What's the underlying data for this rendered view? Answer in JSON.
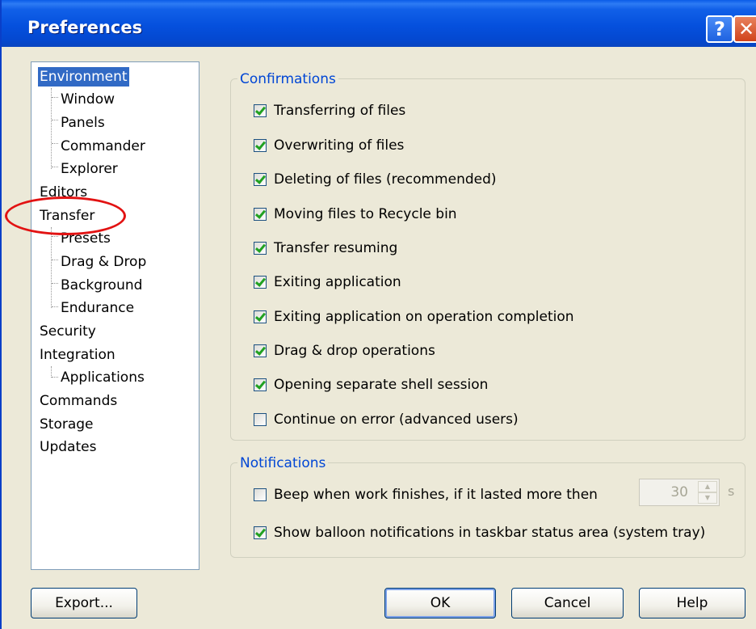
{
  "window": {
    "title": "Preferences",
    "help_glyph": "?",
    "close_glyph": "✕"
  },
  "tree": {
    "items": [
      {
        "label": "Environment",
        "level": 0,
        "selected": true
      },
      {
        "label": "Window",
        "level": 1
      },
      {
        "label": "Panels",
        "level": 1
      },
      {
        "label": "Commander",
        "level": 1
      },
      {
        "label": "Explorer",
        "level": 1
      },
      {
        "label": "Editors",
        "level": 0
      },
      {
        "label": "Transfer",
        "level": 0
      },
      {
        "label": "Presets",
        "level": 1
      },
      {
        "label": "Drag & Drop",
        "level": 1
      },
      {
        "label": "Background",
        "level": 1
      },
      {
        "label": "Endurance",
        "level": 1
      },
      {
        "label": "Security",
        "level": 0
      },
      {
        "label": "Integration",
        "level": 0
      },
      {
        "label": "Applications",
        "level": 1
      },
      {
        "label": "Commands",
        "level": 0
      },
      {
        "label": "Storage",
        "level": 0
      },
      {
        "label": "Updates",
        "level": 0
      }
    ]
  },
  "confirmations": {
    "label": "Confirmations",
    "items": [
      {
        "label": "Transferring of files",
        "checked": true
      },
      {
        "label": "Overwriting of files",
        "checked": true
      },
      {
        "label": "Deleting of files (recommended)",
        "checked": true
      },
      {
        "label": "Moving files to Recycle bin",
        "checked": true
      },
      {
        "label": "Transfer resuming",
        "checked": true
      },
      {
        "label": "Exiting application",
        "checked": true
      },
      {
        "label": "Exiting application on operation completion",
        "checked": true
      },
      {
        "label": "Drag & drop operations",
        "checked": true
      },
      {
        "label": "Opening separate shell session",
        "checked": true
      },
      {
        "label": "Continue on error (advanced users)",
        "checked": false
      }
    ]
  },
  "notifications": {
    "label": "Notifications",
    "beep": {
      "label": "Beep when work finishes, if it lasted more then",
      "checked": false
    },
    "beep_seconds": "30",
    "beep_unit": "s",
    "balloon": {
      "label": "Show balloon notifications in taskbar status area (system tray)",
      "checked": true
    }
  },
  "buttons": {
    "export": "Export...",
    "ok": "OK",
    "cancel": "Cancel",
    "help": "Help"
  },
  "colors": {
    "titlebar": "#0550dd",
    "selection": "#316ac5",
    "group_label": "#0046d5",
    "annotation": "#e21212"
  }
}
